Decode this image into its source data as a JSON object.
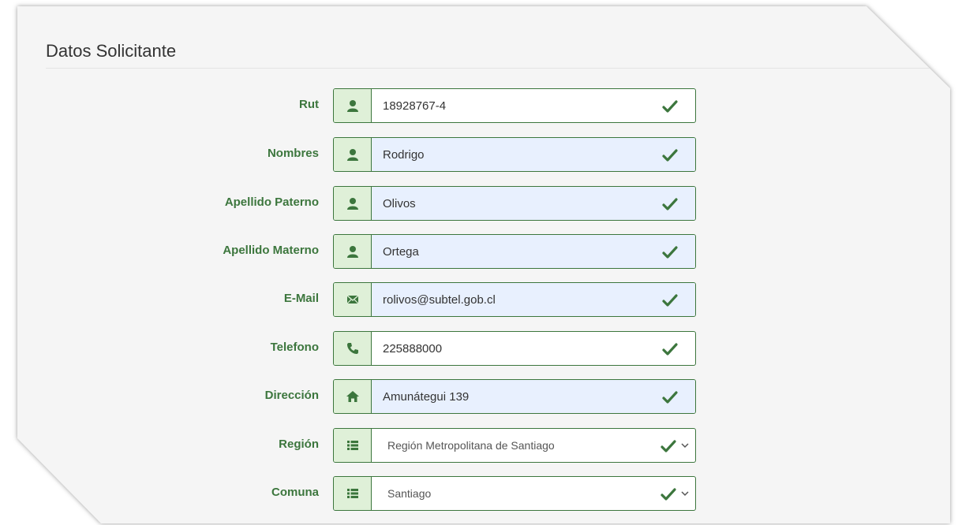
{
  "panel": {
    "title": "Datos Solicitante"
  },
  "fields": [
    {
      "label": "Rut",
      "value": "18928767-4",
      "icon": "user-icon",
      "autofill": false,
      "type": "text"
    },
    {
      "label": "Nombres",
      "value": "Rodrigo",
      "icon": "user-icon",
      "autofill": true,
      "type": "text"
    },
    {
      "label": "Apellido Paterno",
      "value": "Olivos",
      "icon": "user-icon",
      "autofill": true,
      "type": "text"
    },
    {
      "label": "Apellido Materno",
      "value": "Ortega",
      "icon": "user-icon",
      "autofill": true,
      "type": "text"
    },
    {
      "label": "E-Mail",
      "value": "rolivos@subtel.gob.cl",
      "icon": "envelope-icon",
      "autofill": true,
      "type": "text"
    },
    {
      "label": "Telefono",
      "value": "225888000",
      "icon": "phone-icon",
      "autofill": false,
      "type": "text"
    },
    {
      "label": "Dirección",
      "value": "Amunátegui 139",
      "icon": "home-icon",
      "autofill": true,
      "type": "text"
    },
    {
      "label": "Región",
      "value": "Región Metropolitana de Santiago",
      "icon": "list-icon",
      "autofill": false,
      "type": "select"
    },
    {
      "label": "Comuna",
      "value": "Santiago",
      "icon": "list-icon",
      "autofill": false,
      "type": "select"
    }
  ],
  "colors": {
    "success": "#3c763d",
    "addon_bg": "#dff0d8",
    "autofill_bg": "#e8f0fe",
    "panel_bg": "#f5f5f5"
  }
}
